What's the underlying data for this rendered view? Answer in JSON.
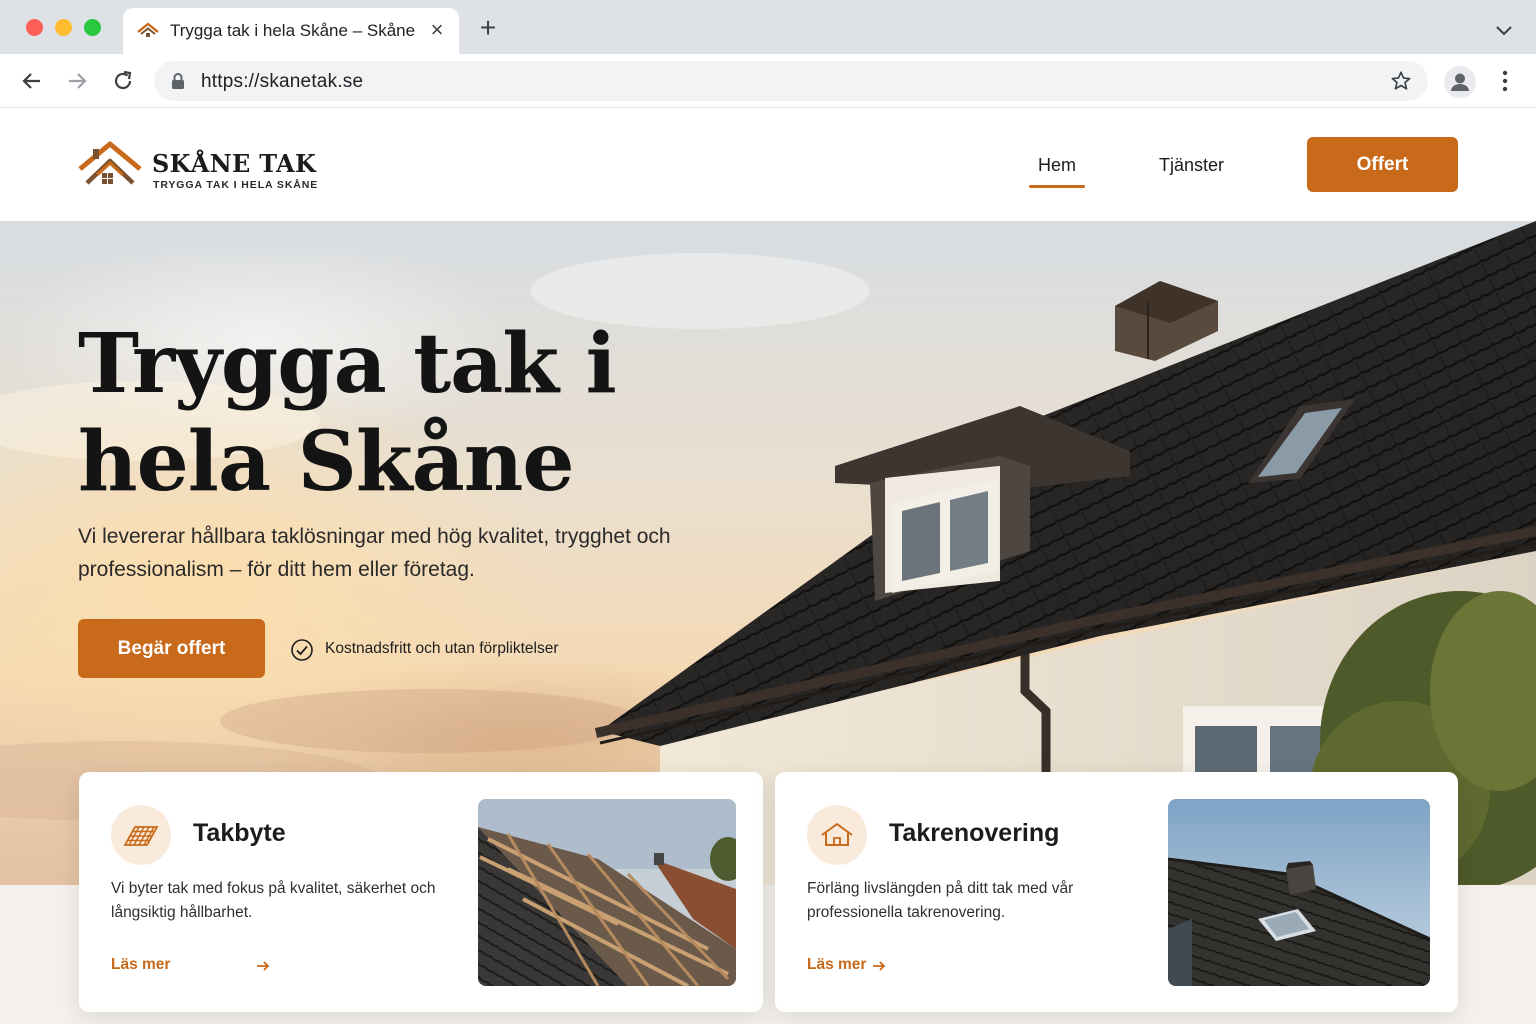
{
  "browser": {
    "tab_title": "Trygga tak i hela Skåne – Skåne Tak",
    "url": "https://skanetak.se"
  },
  "site": {
    "logo_name": "SKÅNE TAK",
    "logo_tagline": "TRYGGA TAK I HELA SKÅNE",
    "nav": {
      "home": "Hem",
      "services": "Tjänster",
      "quote": "Offert"
    }
  },
  "hero": {
    "title_line1": "Trygga tak i",
    "title_line2": "hela Skåne",
    "subtitle": "Vi levererar hållbara taklösningar med hög kvalitet, trygghet och professionalism – för ditt hem eller företag.",
    "cta": "Begär offert",
    "note": "Kostnadsfritt och utan förpliktelser"
  },
  "services": [
    {
      "title": "Takbyte",
      "description": "Vi byter tak med fokus på kvalitet, säkerhet och långsiktig hållbarhet.",
      "link": "Läs mer",
      "icon": "roof-tiles-icon"
    },
    {
      "title": "Takrenovering",
      "description": "Förläng livslängden på ditt tak med vår professionella takrenovering.",
      "link": "Läs mer",
      "icon": "house-icon"
    }
  ],
  "colors": {
    "accent": "#c9691a",
    "accent_light": "#faeadb",
    "text_dark": "#1c1c1c"
  }
}
